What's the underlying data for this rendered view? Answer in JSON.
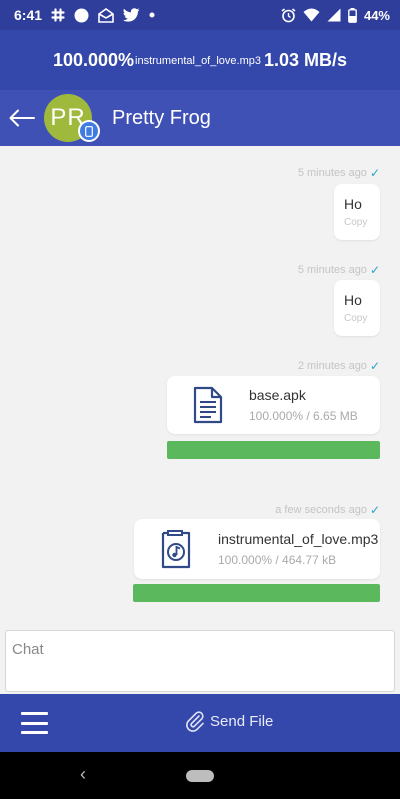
{
  "status_bar": {
    "time": "6:41",
    "battery": "44%",
    "icons": [
      "slack-icon",
      "circle-icon",
      "mail-icon",
      "twitter-icon",
      "dot-icon",
      "alarm-icon",
      "wifi-icon",
      "signal-icon",
      "battery-icon"
    ]
  },
  "transfer": {
    "percent": "100.000%",
    "file": "instrumental_of_love.mp3",
    "speed": "1.03 MB/s"
  },
  "header": {
    "initials": "PR",
    "contact_name": "Pretty Frog",
    "avatar_color": "#9fb93c"
  },
  "messages": [
    {
      "time": "5 minutes ago",
      "text": "Ho",
      "copy": "Copy"
    },
    {
      "time": "5 minutes ago",
      "text": "Ho",
      "copy": "Copy"
    }
  ],
  "files": [
    {
      "time": "2 minutes ago",
      "name": "base.apk",
      "progress": "100.000% / 6.65 MB",
      "fill": 1.0,
      "icon": "document-icon"
    },
    {
      "time": "a few seconds ago",
      "name": "instrumental_of_love.mp3",
      "progress": "100.000% / 464.77 kB",
      "fill": 1.0,
      "icon": "music-file-icon"
    }
  ],
  "chat_input": {
    "placeholder": "Chat",
    "value": ""
  },
  "bottom_bar": {
    "send_file_label": "Send File"
  },
  "colors": {
    "status_bar": "#2f3d9b",
    "header": "#3f51b5",
    "progress": "#5cb85c",
    "check": "#29a3c7"
  }
}
